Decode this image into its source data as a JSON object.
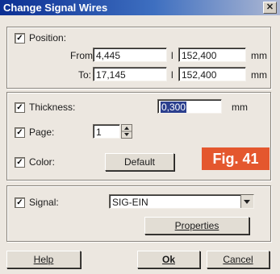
{
  "window": {
    "title": "Change Signal Wires",
    "close_glyph": "✕"
  },
  "position": {
    "label": "Position:",
    "checked": true,
    "from_label": "From:",
    "to_label": "To:",
    "from_x": "4,445",
    "from_y": "152,400",
    "to_x": "17,145",
    "to_y": "152,400",
    "separator": "l",
    "unit": "mm"
  },
  "thickness": {
    "label": "Thickness:",
    "checked": true,
    "value": "0,300",
    "unit": "mm"
  },
  "page": {
    "label": "Page:",
    "checked": true,
    "value": "1"
  },
  "color": {
    "label": "Color:",
    "checked": true,
    "button": "Default"
  },
  "figure_tag": {
    "text": "Fig. 41",
    "color": "#e4572e"
  },
  "signal": {
    "label": "Signal:",
    "checked": true,
    "value": "SIG-EIN",
    "properties_button": "Properties"
  },
  "buttons": {
    "help": "Help",
    "ok": "Ok",
    "cancel": "Cancel"
  },
  "check_glyph": "✓",
  "icons": {
    "dropdown": "chevron-down-icon",
    "spinner": "spinner-arrows-icon"
  }
}
